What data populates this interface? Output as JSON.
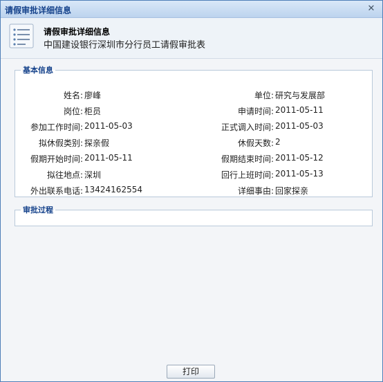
{
  "window": {
    "title": "请假审批详细信息",
    "close_glyph": "✕"
  },
  "header": {
    "title": "请假审批详细信息",
    "subtitle": "中国建设银行深圳市分行员工请假审批表",
    "icon": "list-document-icon"
  },
  "basic_info": {
    "legend": "基本信息",
    "rows": [
      {
        "left_label": "姓名:",
        "left_value": "廖峰",
        "right_label": "单位:",
        "right_value": "研究与发展部"
      },
      {
        "left_label": "岗位:",
        "left_value": "柜员",
        "right_label": "申请时间:",
        "right_value": "2011-05-11"
      },
      {
        "left_label": "参加工作时间:",
        "left_value": "2011-05-03",
        "right_label": "正式调入时间:",
        "right_value": "2011-05-03"
      },
      {
        "left_label": "拟休假类别:",
        "left_value": "探亲假",
        "right_label": "休假天数:",
        "right_value": "2"
      },
      {
        "left_label": "假期开始时间:",
        "left_value": "2011-05-11",
        "right_label": "假期结束时间:",
        "right_value": "2011-05-12"
      },
      {
        "left_label": "拟往地点:",
        "left_value": "深圳",
        "right_label": "回行上班时间:",
        "right_value": "2011-05-13"
      },
      {
        "left_label": "外出联系电话:",
        "left_value": "13424162554",
        "right_label": "详细事由:",
        "right_value": "回家探亲"
      }
    ]
  },
  "approval_process": {
    "legend": "审批过程"
  },
  "footer": {
    "print_label": "打印"
  },
  "colors": {
    "title_text": "#15428b",
    "border": "#4f7fb8"
  }
}
